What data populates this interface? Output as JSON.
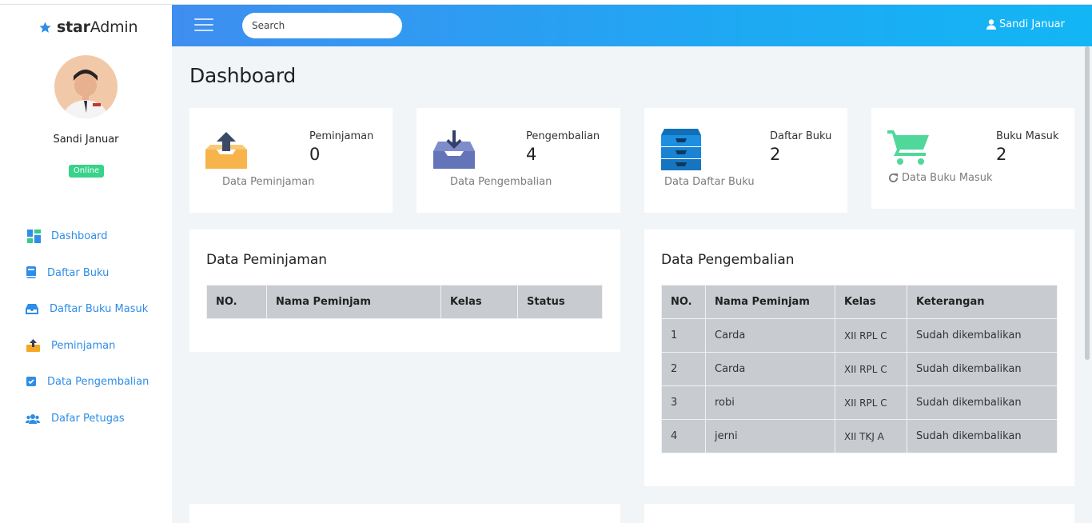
{
  "brand": {
    "bold": "star",
    "regular": "Admin"
  },
  "profile": {
    "name": "Sandi Januar",
    "status": "Online"
  },
  "sidebar": {
    "items": [
      {
        "label": "Dashboard",
        "icon": "dashboard-icon"
      },
      {
        "label": "Daftar Buku",
        "icon": "book-icon"
      },
      {
        "label": "Daftar Buku Masuk",
        "icon": "inbox-icon"
      },
      {
        "label": "Peminjaman",
        "icon": "upload-box-icon"
      },
      {
        "label": "Data Pengembalian",
        "icon": "checkbox-icon"
      },
      {
        "label": "Dafar Petugas",
        "icon": "users-icon"
      }
    ]
  },
  "header": {
    "search_placeholder": "Search",
    "user_name": "Sandi Januar"
  },
  "page": {
    "title": "Dashboard"
  },
  "stats": [
    {
      "label": "Peminjaman",
      "value": "0",
      "link": "Data Peminjaman",
      "icon": "upload-tray-icon"
    },
    {
      "label": "Pengembalian",
      "value": "4",
      "link": "Data Pengembalian",
      "icon": "download-tray-icon"
    },
    {
      "label": "Daftar Buku",
      "value": "2",
      "link": "Data Daftar Buku",
      "icon": "archive-drawers-icon"
    },
    {
      "label": "Buku Masuk",
      "value": "2",
      "link": "Data Buku Masuk",
      "icon": "shopping-cart-icon"
    }
  ],
  "peminjaman_table": {
    "title": "Data Peminjaman",
    "headers": [
      "NO.",
      "Nama Peminjam",
      "Kelas",
      "Status"
    ]
  },
  "pengembalian_table": {
    "title": "Data Pengembalian",
    "headers": [
      "NO.",
      "Nama Peminjam",
      "Kelas",
      "Keterangan"
    ],
    "rows": [
      [
        "1",
        "Carda",
        "XII RPL C",
        "Sudah dikembalikan"
      ],
      [
        "2",
        "Carda",
        "XII RPL C",
        "Sudah dikembalikan"
      ],
      [
        "3",
        "robi",
        "XII RPL C",
        "Sudah dikembalikan"
      ],
      [
        "4",
        "jerni",
        "XII TKJ A",
        "Sudah dikembalikan"
      ]
    ]
  },
  "colors": {
    "accent": "#2e8de6",
    "online": "#37d38a",
    "header_start": "#3f8ef0",
    "header_end": "#12b6f5"
  }
}
